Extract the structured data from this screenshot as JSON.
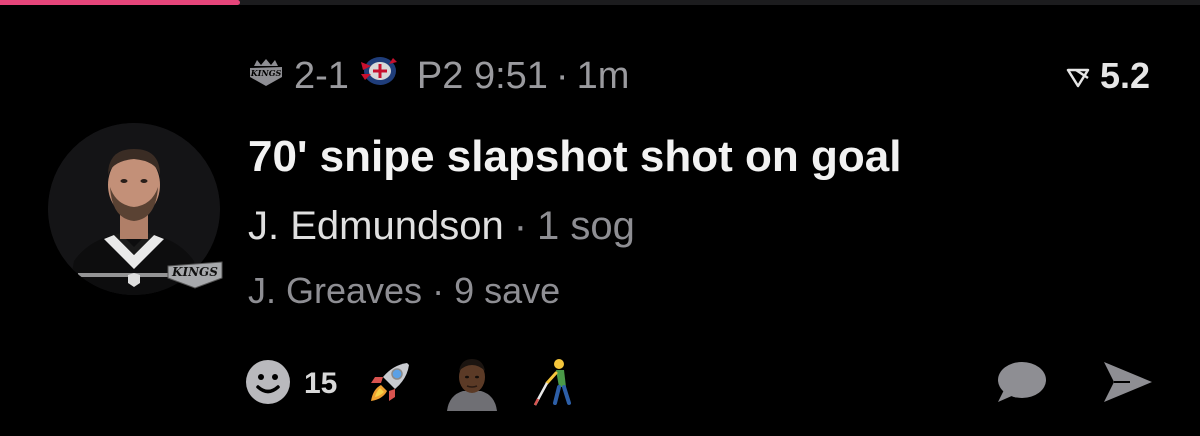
{
  "progress": {
    "fraction": 0.2,
    "color": "#e5457a"
  },
  "meta": {
    "home_team_icon": "kings-logo-icon",
    "score": "2-1",
    "away_team_icon": "blue-jackets-logo-icon",
    "period_clock": "P2 9:51",
    "separator": "·",
    "age": "1m"
  },
  "rating": {
    "icon": "rating-arrow-icon",
    "value": "5.2"
  },
  "event": {
    "headline": "70' snipe slapshot shot on goal",
    "shooter_name": "J. Edmundson",
    "shooter_stat": "1 sog",
    "goalie_name": "J. Greaves",
    "goalie_stat": "9 save",
    "separator": "·"
  },
  "avatar": {
    "badge_text": "KINGS",
    "icon": "player-photo"
  },
  "reactions": {
    "add_icon": "smiley-face-icon",
    "count": "15",
    "emojis": [
      "rocket-emoji",
      "person-face-emoji",
      "person-with-white-cane-emoji"
    ]
  },
  "actions": {
    "comment_icon": "comment-bubble-icon",
    "share_icon": "send-arrow-icon"
  },
  "colors": {
    "background": "#000000",
    "primary_text": "#f2f2f2",
    "secondary_text": "#8e8e93",
    "accent": "#e5457a"
  }
}
